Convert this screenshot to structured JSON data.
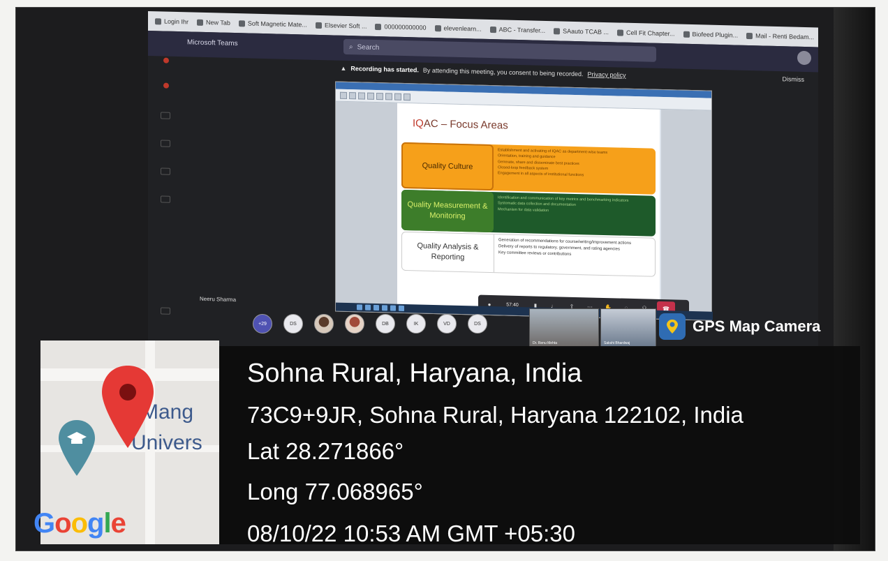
{
  "browser": {
    "tabs": [
      "Login Ihr",
      "New Tab",
      "Soft Magnetic Mate...",
      "Elsevier Soft ...",
      "000000000000",
      "elevenlearn...",
      "ABC - Transfer...",
      "SAauto TCAB ...",
      "Cell Fit Chapter...",
      "Biofeed Plugin...",
      "Mail - Renti Bedam..."
    ]
  },
  "teams": {
    "app_title": "Microsoft Teams",
    "search_placeholder": "Search",
    "recording_bold": "Recording has started.",
    "recording_text": "By attending this meeting, you consent to being recorded.",
    "privacy_link": "Privacy policy",
    "dismiss": "Dismiss",
    "speaker_name": "Neeru Sharma"
  },
  "slide": {
    "title_prefix": "IQ",
    "title_rest": "AC – Focus Areas",
    "rows": [
      {
        "label": "Quality Culture",
        "bullets": [
          "Establishment and activating of IQAC as department-wise teams",
          "Orientation, training and guidance",
          "Generate, share and disseminate best practices",
          "Closed-loop feedback system",
          "Engagement in all aspects of institutional functions"
        ]
      },
      {
        "label": "Quality Measurement & Monitoring",
        "bullets": [
          "Identification and communication of key metrics and benchmarking indicators",
          "Systematic data collection and documentation",
          "Mechanism for data validation"
        ]
      },
      {
        "label": "Quality Analysis & Reporting",
        "bullets": [
          "Generation of recommendations for course/writing/improvement actions",
          "Delivery of reports to regulatory, government, and rating agencies",
          "Key committee reviews or contributions"
        ]
      }
    ]
  },
  "call_controls": {
    "timer": "57:40"
  },
  "participants": {
    "more_count": "+29",
    "initials": [
      "DS",
      "DB",
      "IK",
      "VD",
      "DS"
    ]
  },
  "video_tiles": [
    {
      "name": "Dr. Renu Mehta"
    },
    {
      "name": "Sakshi Bhardwaj"
    }
  ],
  "map": {
    "place_line1": "Mang",
    "place_line2": "Univers",
    "brand": "Google"
  },
  "gps": {
    "brand_label": "GPS Map Camera",
    "location": "Sohna Rural, Haryana, India",
    "address": "73C9+9JR, Sohna Rural, Haryana 122102, India",
    "lat": "Lat 28.271866°",
    "long": "Long 77.068965°",
    "datetime": "08/10/22 10:53 AM GMT +05:30"
  }
}
